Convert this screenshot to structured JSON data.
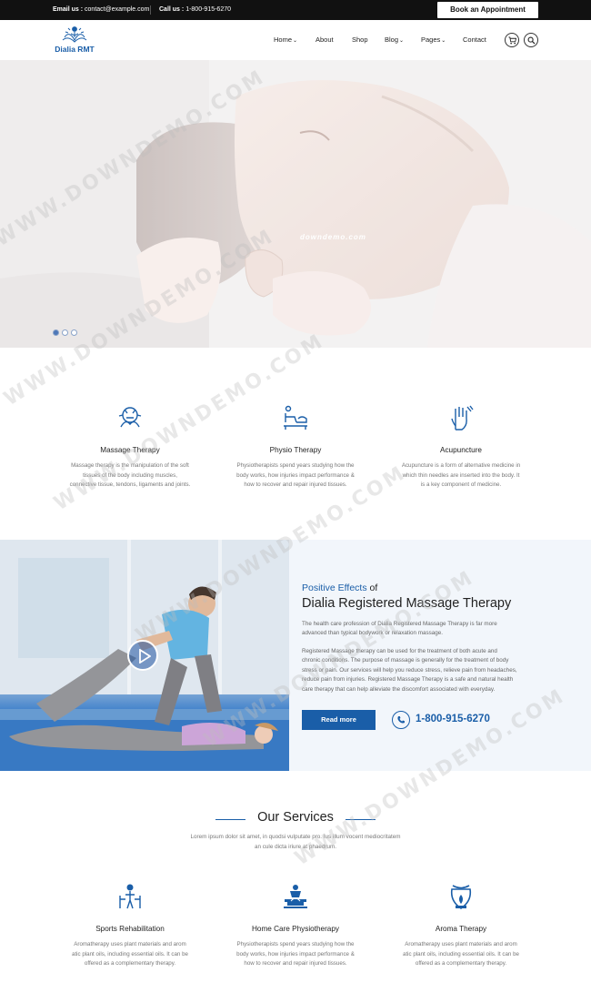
{
  "topbar": {
    "email_label": "Email us :",
    "email_value": "contact@example.com",
    "call_label": "Call us :",
    "call_value": "1-800-915-6270",
    "book_button": "Book an Appointment"
  },
  "header": {
    "logo_text": "Dialia RMT",
    "nav": [
      {
        "label": "Home",
        "dropdown": true
      },
      {
        "label": "About",
        "dropdown": false
      },
      {
        "label": "Shop",
        "dropdown": false
      },
      {
        "label": "Blog",
        "dropdown": true
      },
      {
        "label": "Pages",
        "dropdown": true
      },
      {
        "label": "Contact",
        "dropdown": false
      }
    ],
    "chevron": "⌄"
  },
  "hero": {
    "watermark": "downdemo.com",
    "slides": 3,
    "active_slide": 1
  },
  "features": [
    {
      "icon": "massage-hands-icon",
      "title": "Massage Therapy",
      "text": [
        "Massage therapy is the manipulation of the soft",
        "tissues of the body including muscles,",
        "connective tissue, tendons, ligaments and joints."
      ]
    },
    {
      "icon": "therapy-bed-icon",
      "title": "Physio Therapy",
      "text": [
        "Physiotherapists spend years studying how the",
        "body works, how injuries impact performance &",
        "how to recover and repair injured tissues."
      ]
    },
    {
      "icon": "acupuncture-hand-icon",
      "title": "Acupuncture",
      "text": [
        "Acupuncture is a form of alternative medicine in",
        "which thin needles are inserted into the body. It",
        "is a key component of medicine."
      ]
    }
  ],
  "about": {
    "subtitle_highlight": "Positive Effects",
    "subtitle_rest": " of",
    "title": "Dialia Registered Massage Therapy",
    "paragraph1": [
      "The health care profession of Dialia Registered Massage Therapy is far more",
      "advanced than typical bodywork or relaxation massage."
    ],
    "paragraph2": [
      "Registered Massage therapy can be used for the treatment of both acute and",
      "chronic conditions. The purpose of massage is generally for the treatment of body",
      "stress or pain. Our services will help you reduce stress, relieve pain from headaches,",
      "reduce pain from injuries. Registered Massage Therapy is a safe and natural health",
      "care therapy that can help alleviate the discomfort associated with everyday."
    ],
    "button": "Read more",
    "phone": "1-800-915-6270"
  },
  "services": {
    "title": "Our Services",
    "desc": [
      "Lorem ipsum dolor sit amet, in quodsi vulputate pro. Ius illum vocent mediocritatem",
      "an cule dicta iriure at phaedrum."
    ],
    "items": [
      {
        "icon": "rehab-icon",
        "title": "Sports Rehabilitation",
        "text": [
          "Aromatherapy uses plant materials and arom",
          "atic plant oils, including essential oils. It can be",
          "offered as a complementary therapy."
        ]
      },
      {
        "icon": "home-physio-icon",
        "title": "Home Care Physiotherapy",
        "text": [
          "Physiotherapists spend years studying how the",
          "body works, how injuries impact performance &",
          "how to recover and repair injured tissues."
        ]
      },
      {
        "icon": "aroma-lamp-icon",
        "title": "Aroma Therapy",
        "text": [
          "Aromatherapy uses plant materials and arom",
          "atic plant oils, including essential oils. It can be",
          "offered as a complementary therapy."
        ]
      }
    ]
  },
  "watermark": "WWW.DOWNDEMO.COM",
  "colors": {
    "brand": "#1a5ea8",
    "topbar": "#111111",
    "about_bg": "#f2f6fb"
  }
}
